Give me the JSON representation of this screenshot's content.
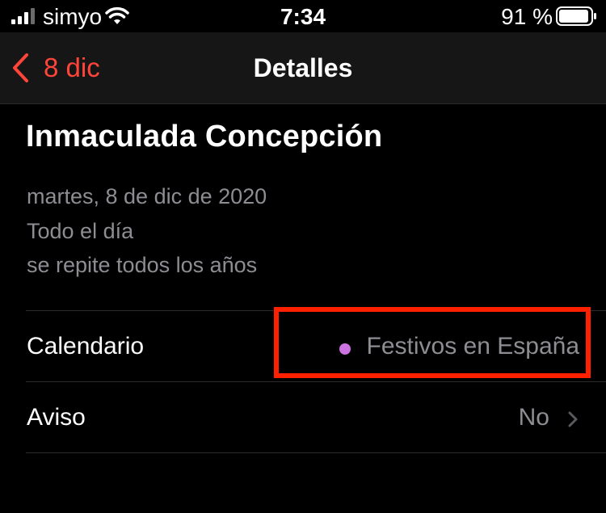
{
  "status_bar": {
    "carrier": "simyo",
    "time": "7:34",
    "battery_percent": "91 %"
  },
  "nav": {
    "back_label": "8 dic",
    "title": "Detalles"
  },
  "event": {
    "title": "Inmaculada Concepción",
    "date": "martes, 8 de dic de 2020",
    "all_day": "Todo el día",
    "repeat": "se repite todos los años"
  },
  "rows": {
    "calendar": {
      "label": "Calendario",
      "value": "Festivos en España",
      "dot_color": "#cc73e1"
    },
    "alert": {
      "label": "Aviso",
      "value": "No"
    }
  },
  "colors": {
    "accent": "#ff453a",
    "highlight": "#ff2000",
    "secondary_text": "#8d8d93"
  }
}
